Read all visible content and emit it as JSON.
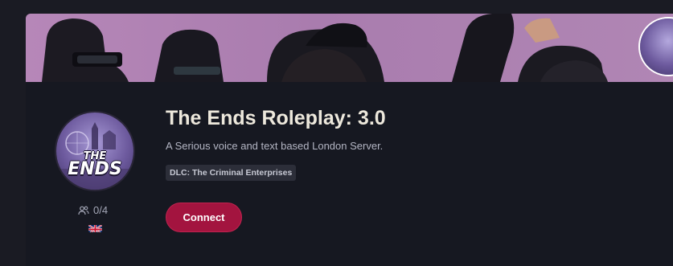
{
  "server": {
    "title": "The Ends Roleplay: 3.0",
    "description": "A Serious voice and text based London Server.",
    "tag": "DLC: The Criminal Enterprises",
    "players": "0/4",
    "connect_label": "Connect",
    "flag": "uk-flag-icon",
    "logo": {
      "line1": "THE",
      "line2": "ENDS"
    }
  },
  "icons": {
    "players": "users-icon"
  },
  "colors": {
    "background": "#161821",
    "connect_button": "#a3143f",
    "banner": "#b687b8",
    "title": "#ede8dc"
  }
}
